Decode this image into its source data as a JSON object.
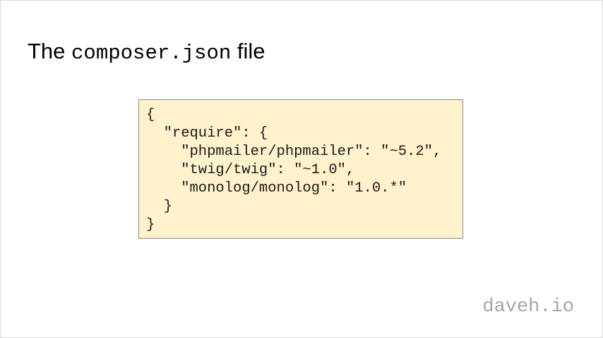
{
  "title": {
    "prefix": "The ",
    "filename": "composer.json",
    "suffix": " file"
  },
  "code": {
    "lines": [
      "{",
      "  \"require\": {",
      "    \"phpmailer/phpmailer\": \"~5.2\",",
      "    \"twig/twig\": \"~1.0\",",
      "    \"monolog/monolog\": \"1.0.*\"",
      "  }",
      "}"
    ],
    "background_color": "#fff2cc",
    "border_color": "#8c8c8c"
  },
  "footer": {
    "brand": "daveh.io",
    "color": "#a6a6a6"
  }
}
